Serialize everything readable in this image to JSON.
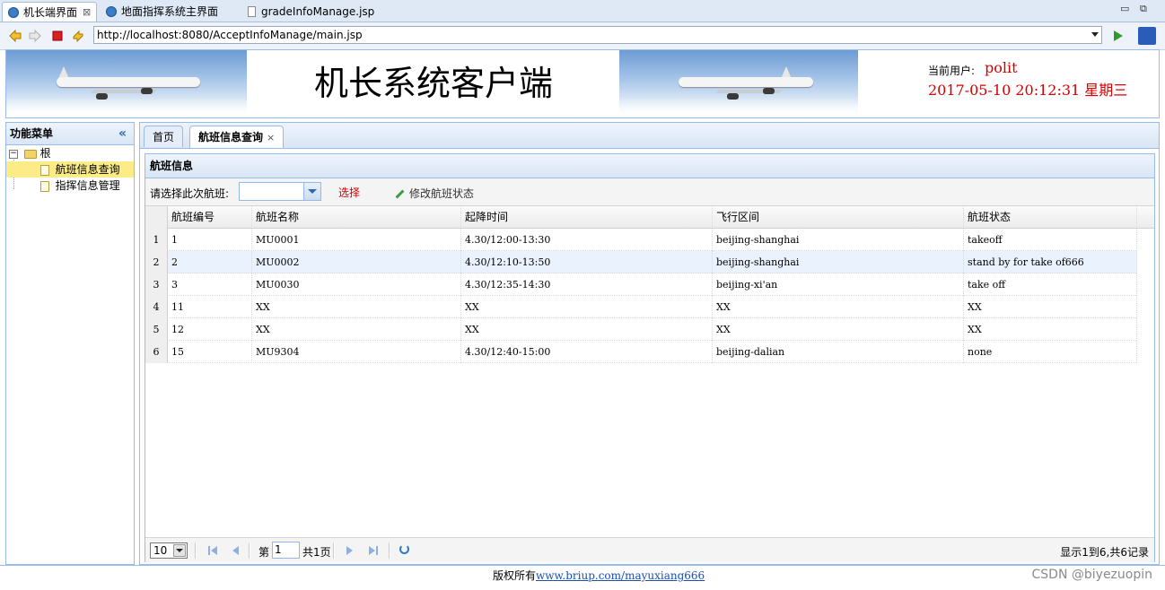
{
  "browser": {
    "tabs": [
      {
        "label": "机长端界面",
        "active": true,
        "close": "⊠"
      },
      {
        "label": "地面指挥系统主界面",
        "active": false
      },
      {
        "label": "gradeInfoManage.jsp",
        "active": false
      }
    ],
    "url": "http://localhost:8080/AcceptInfoManage/main.jsp",
    "window_controls": {
      "minimize": "▭",
      "restore": "⧉"
    }
  },
  "header": {
    "title": "机长系统客户端",
    "user_label": "当前用户:",
    "user_name": "polit",
    "datetime": "2017-05-10 20:12:31 星期三"
  },
  "menu": {
    "title": "功能菜单",
    "collapse_glyph": "«",
    "root": {
      "label": "根",
      "expander": "−"
    },
    "items": [
      {
        "label": "航班信息查询",
        "selected": true
      },
      {
        "label": "指挥信息管理",
        "selected": false
      }
    ]
  },
  "main_tabs": [
    {
      "label": "首页",
      "active": false
    },
    {
      "label": "航班信息查询",
      "active": true,
      "close": "×"
    }
  ],
  "panel": {
    "title": "航班信息",
    "toolbar": {
      "select_label": "请选择此次航班:",
      "select_value": "",
      "choose_label": "选择",
      "edit_label": "修改航班状态"
    }
  },
  "grid": {
    "columns": [
      "航班编号",
      "航班名称",
      "起降时间",
      "飞行区间",
      "航班状态"
    ],
    "rows": [
      {
        "n": "1",
        "cells": [
          "1",
          "MU0001",
          "4.30/12:00-13:30",
          "beijing-shanghai",
          "takeoff"
        ]
      },
      {
        "n": "2",
        "cells": [
          "2",
          "MU0002",
          "4.30/12:10-13:50",
          "beijing-shanghai",
          "stand by for take of666"
        ]
      },
      {
        "n": "3",
        "cells": [
          "3",
          "MU0030",
          "4.30/12:35-14:30",
          "beijing-xi'an",
          "take off"
        ]
      },
      {
        "n": "4",
        "cells": [
          "11",
          "XX",
          "XX",
          "XX",
          "XX"
        ]
      },
      {
        "n": "5",
        "cells": [
          "12",
          "XX",
          "XX",
          "XX",
          "XX"
        ]
      },
      {
        "n": "6",
        "cells": [
          "15",
          "MU9304",
          "4.30/12:40-15:00",
          "beijing-dalian",
          "none"
        ]
      }
    ]
  },
  "pager": {
    "page_size": "10",
    "page_label": "第",
    "page_value": "1",
    "total_label": "共1页",
    "info": "显示1到6,共6记录"
  },
  "footer": {
    "text": "版权所有",
    "link": "www.briup.com/mayuxiang666",
    "watermark": "CSDN @biyezuopin"
  },
  "colors": {
    "accent_red": "#d40000",
    "panel_border": "#99bbe8",
    "selected_row": "#fbec88",
    "link_blue": "#1a50b0"
  }
}
